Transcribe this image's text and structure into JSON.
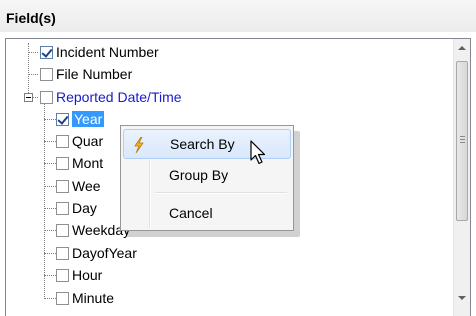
{
  "header": {
    "title": "Field(s)"
  },
  "tree": {
    "items": [
      {
        "label": "Incident Number",
        "checked": true
      },
      {
        "label": "File Number",
        "checked": false
      },
      {
        "label": "Reported Date/Time",
        "checked": false,
        "expanded": true
      },
      {
        "label": "Year",
        "checked": true,
        "selected": true
      },
      {
        "label": "Quar",
        "checked": false
      },
      {
        "label": "Mont",
        "checked": false
      },
      {
        "label": "Wee",
        "checked": false
      },
      {
        "label": "Day",
        "checked": false
      },
      {
        "label": "Weekday",
        "checked": false
      },
      {
        "label": "DayofYear",
        "checked": false
      },
      {
        "label": "Hour",
        "checked": false
      },
      {
        "label": "Minute",
        "checked": false
      }
    ]
  },
  "context_menu": {
    "items": [
      {
        "label": "Search By",
        "icon": "lightning-bolt-icon",
        "highlighted": true
      },
      {
        "label": "Group By"
      },
      {
        "label": "Cancel"
      }
    ]
  },
  "colors": {
    "blue_text": "#1a1ad0",
    "selection": "#3399ff",
    "menu_highlight": "#d9e8fb"
  }
}
